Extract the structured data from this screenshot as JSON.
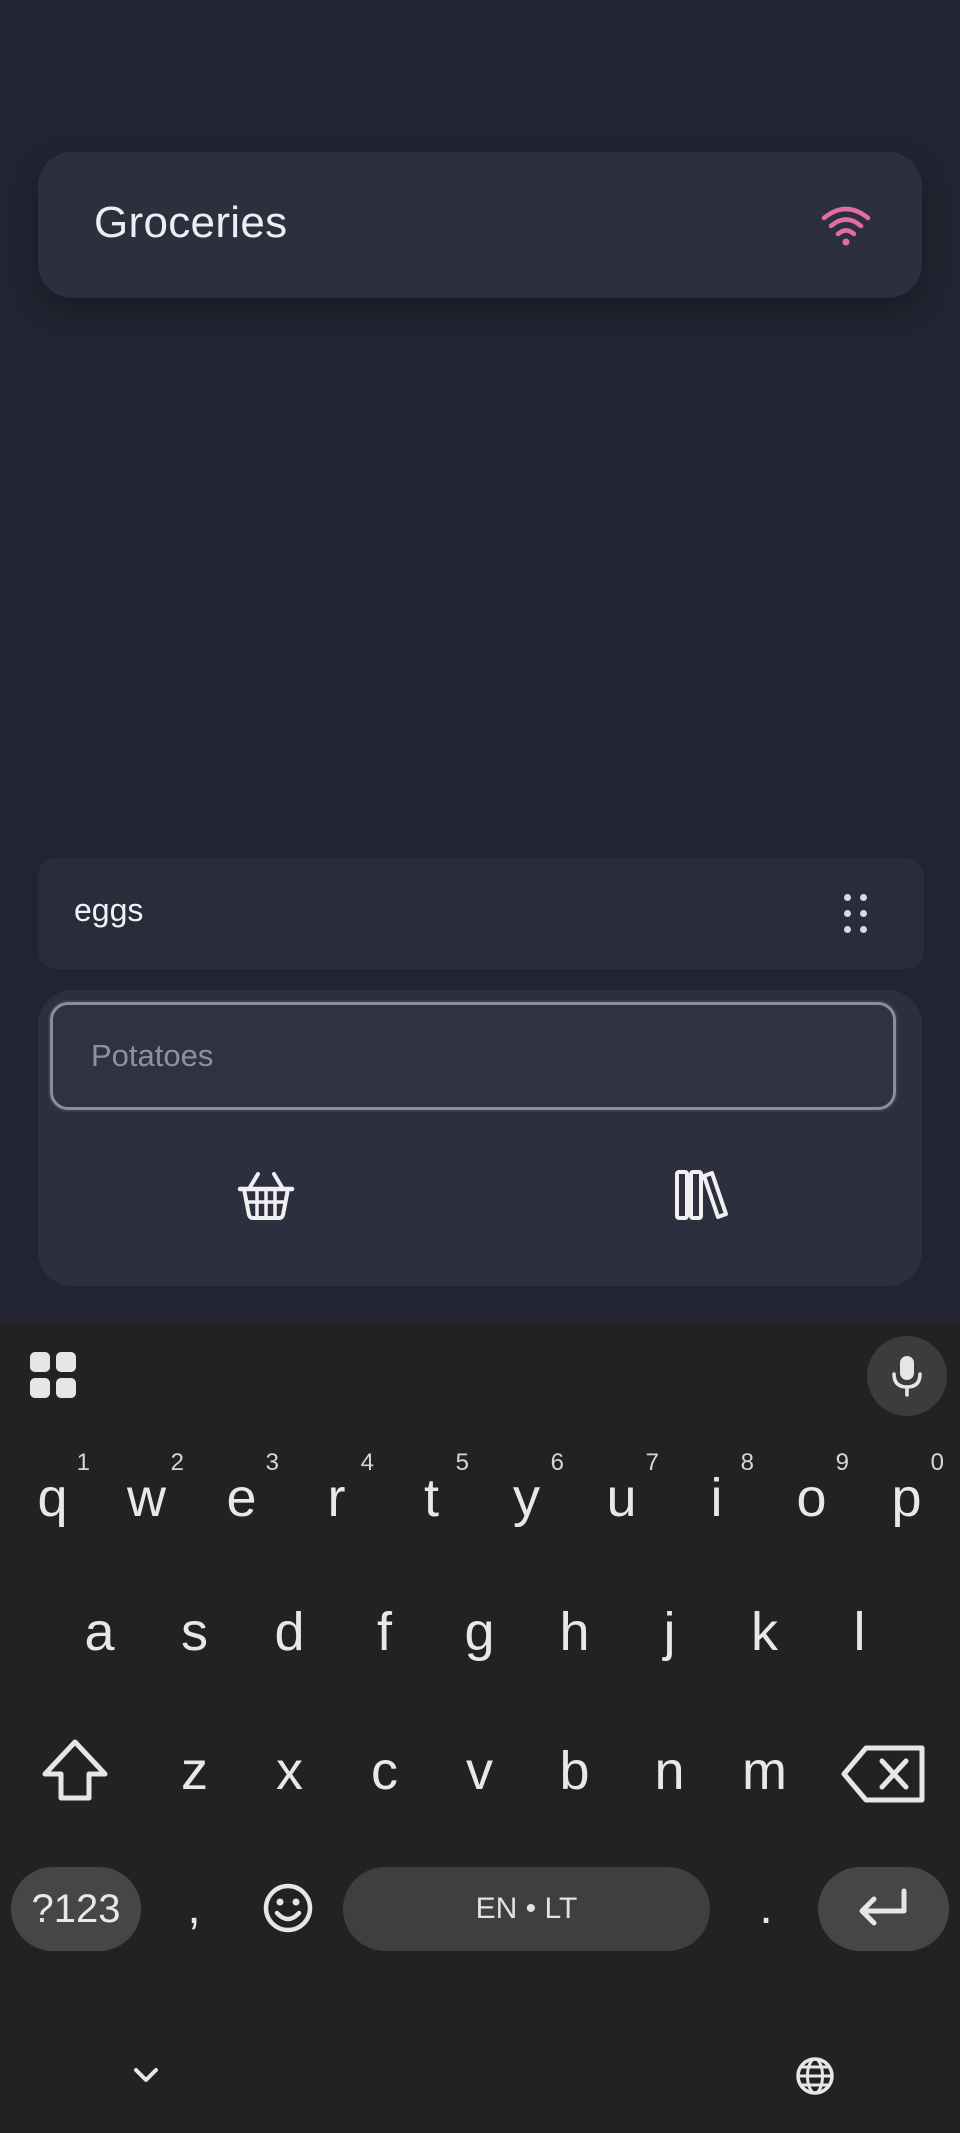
{
  "header": {
    "title": "Groceries",
    "status_icon": "wifi-icon",
    "accent": "#e26ca8"
  },
  "list": {
    "items": [
      {
        "label": "eggs"
      }
    ]
  },
  "add_panel": {
    "input_placeholder": "Potatoes",
    "buttons": [
      {
        "icon": "basket-icon"
      },
      {
        "icon": "library-icon"
      }
    ]
  },
  "keyboard": {
    "row1": [
      {
        "ch": "q",
        "hint": "1"
      },
      {
        "ch": "w",
        "hint": "2"
      },
      {
        "ch": "e",
        "hint": "3"
      },
      {
        "ch": "r",
        "hint": "4"
      },
      {
        "ch": "t",
        "hint": "5"
      },
      {
        "ch": "y",
        "hint": "6"
      },
      {
        "ch": "u",
        "hint": "7"
      },
      {
        "ch": "i",
        "hint": "8"
      },
      {
        "ch": "o",
        "hint": "9"
      },
      {
        "ch": "p",
        "hint": "0"
      }
    ],
    "row2": [
      "a",
      "s",
      "d",
      "f",
      "g",
      "h",
      "j",
      "k",
      "l"
    ],
    "row3": [
      "z",
      "x",
      "c",
      "v",
      "b",
      "n",
      "m"
    ],
    "symbols_label": "?123",
    "comma": ",",
    "space_label": "EN • LT",
    "period": "."
  }
}
